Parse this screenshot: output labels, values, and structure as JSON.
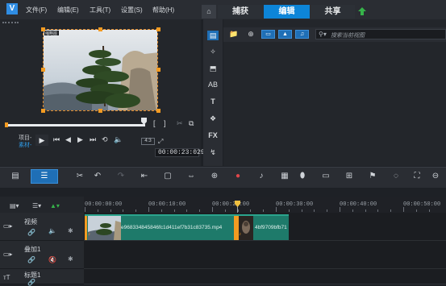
{
  "menu": {
    "logo": "V",
    "items": [
      "文件(F)",
      "编辑(E)",
      "工具(T)",
      "设置(S)",
      "帮助(H)"
    ]
  },
  "workspace_tabs": {
    "home_icon": "home-icon",
    "capture": "捕获",
    "edit": "编辑",
    "share": "共享",
    "upload_icon": "upload-arrow-icon"
  },
  "player": {
    "preview_label": "缩略图",
    "project_label": "项目-",
    "clip_label": "素材-",
    "zoom": "4:3",
    "timecode": "00:00:23:029",
    "mark_in": "[",
    "mark_out": "]"
  },
  "library": {
    "search_placeholder": "搜索当前视图",
    "fx_label": "FX",
    "t_label": "T",
    "ab_label": "AB"
  },
  "timeline": {
    "ruler_labels": [
      "00:00:00:00",
      "00:00:10:00",
      "00:00:20:00",
      "00:00:30:00",
      "00:00:40:00",
      "00:00:50:00"
    ],
    "tracks": [
      {
        "name": "视频"
      },
      {
        "name": "叠加1"
      },
      {
        "name": "标题1"
      }
    ],
    "clips": [
      {
        "name": "e96833484584 6fc1d411ef7b31c83735.mp4",
        "label": "e968334845846fc1d411ef7b31c83735.mp4"
      },
      {
        "name": "4bf9709bfb712",
        "label": "4bf9709bfb712"
      }
    ]
  },
  "colors": {
    "accent": "#0d85d8",
    "handle": "#f39b21",
    "clip": "#1e7a6a"
  }
}
